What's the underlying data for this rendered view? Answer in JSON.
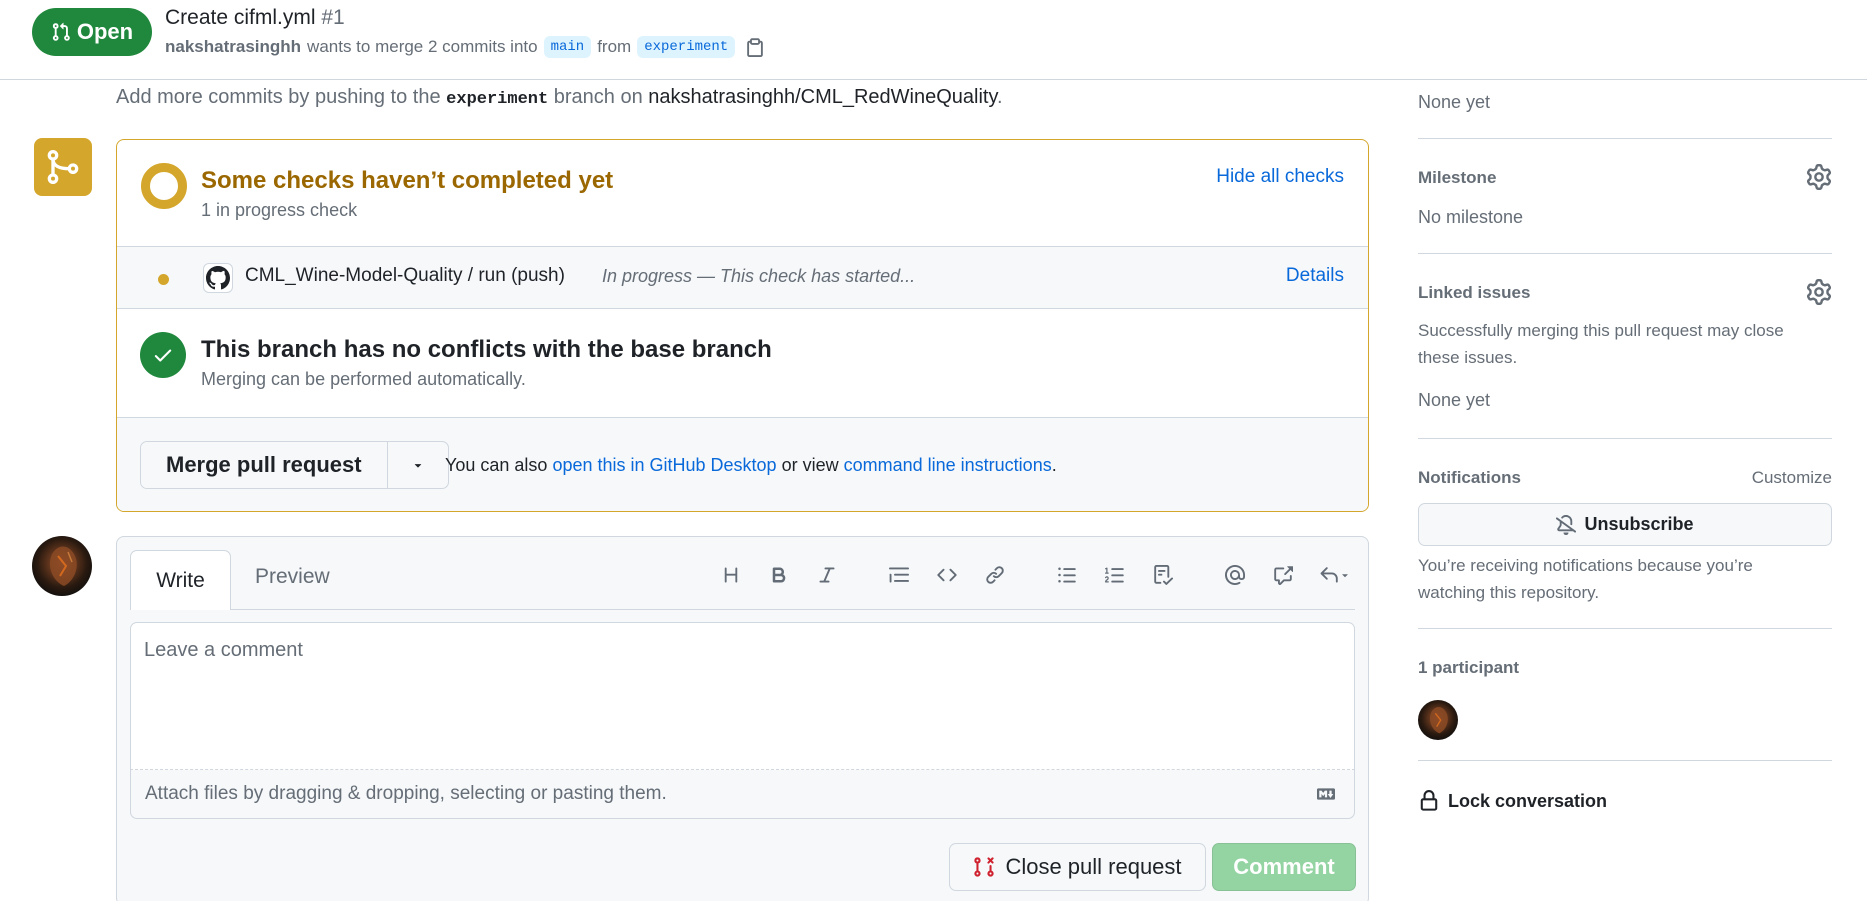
{
  "header": {
    "state": "Open",
    "title": "Create cifml.yml",
    "number": "#1",
    "author": "nakshatrasinghh",
    "merge_text": "wants to merge 2 commits into",
    "base_branch": "main",
    "from_text": "from",
    "head_branch": "experiment"
  },
  "push_hint": {
    "prefix": "Add more commits by pushing to the",
    "branch": "experiment",
    "middle": "branch on",
    "repo": "nakshatrasinghh/CML_RedWineQuality",
    "suffix": "."
  },
  "checks": {
    "title": "Some checks haven’t completed yet",
    "subtitle": "1 in progress check",
    "hide_link": "Hide all checks",
    "items": [
      {
        "name": "CML_Wine-Model-Quality / run (push)",
        "status": "In progress — This check has started...",
        "details": "Details"
      }
    ]
  },
  "conflicts": {
    "title": "This branch has no conflicts with the base branch",
    "subtitle": "Merging can be performed automatically."
  },
  "merge": {
    "button": "Merge pull request",
    "alt_prefix": "You can also",
    "desktop_link": "open this in GitHub Desktop",
    "alt_middle": "or view",
    "cli_link": "command line instructions",
    "alt_suffix": "."
  },
  "composer": {
    "tab_write": "Write",
    "tab_preview": "Preview",
    "placeholder": "Leave a comment",
    "attach_text": "Attach files by dragging & dropping, selecting or pasting them.",
    "close_button": "Close pull request",
    "comment_button": "Comment"
  },
  "sidebar": {
    "labels_value": "None yet",
    "milestone_heading": "Milestone",
    "milestone_value": "No milestone",
    "linked_heading": "Linked issues",
    "linked_desc_1": "Successfully merging this pull request may close",
    "linked_desc_2": "these issues.",
    "linked_value": "None yet",
    "notifications_heading": "Notifications",
    "customize": "Customize",
    "unsubscribe": "Unsubscribe",
    "notif_desc_1": "You’re receiving notifications because you’re",
    "notif_desc_2": "watching this repository.",
    "participants": "1 participant",
    "lock": "Lock conversation"
  },
  "colors": {
    "open_green": "#1f883d",
    "pending_yellow": "#d4a72c",
    "link_blue": "#0969da",
    "comment_disabled": "#94d3a2"
  }
}
